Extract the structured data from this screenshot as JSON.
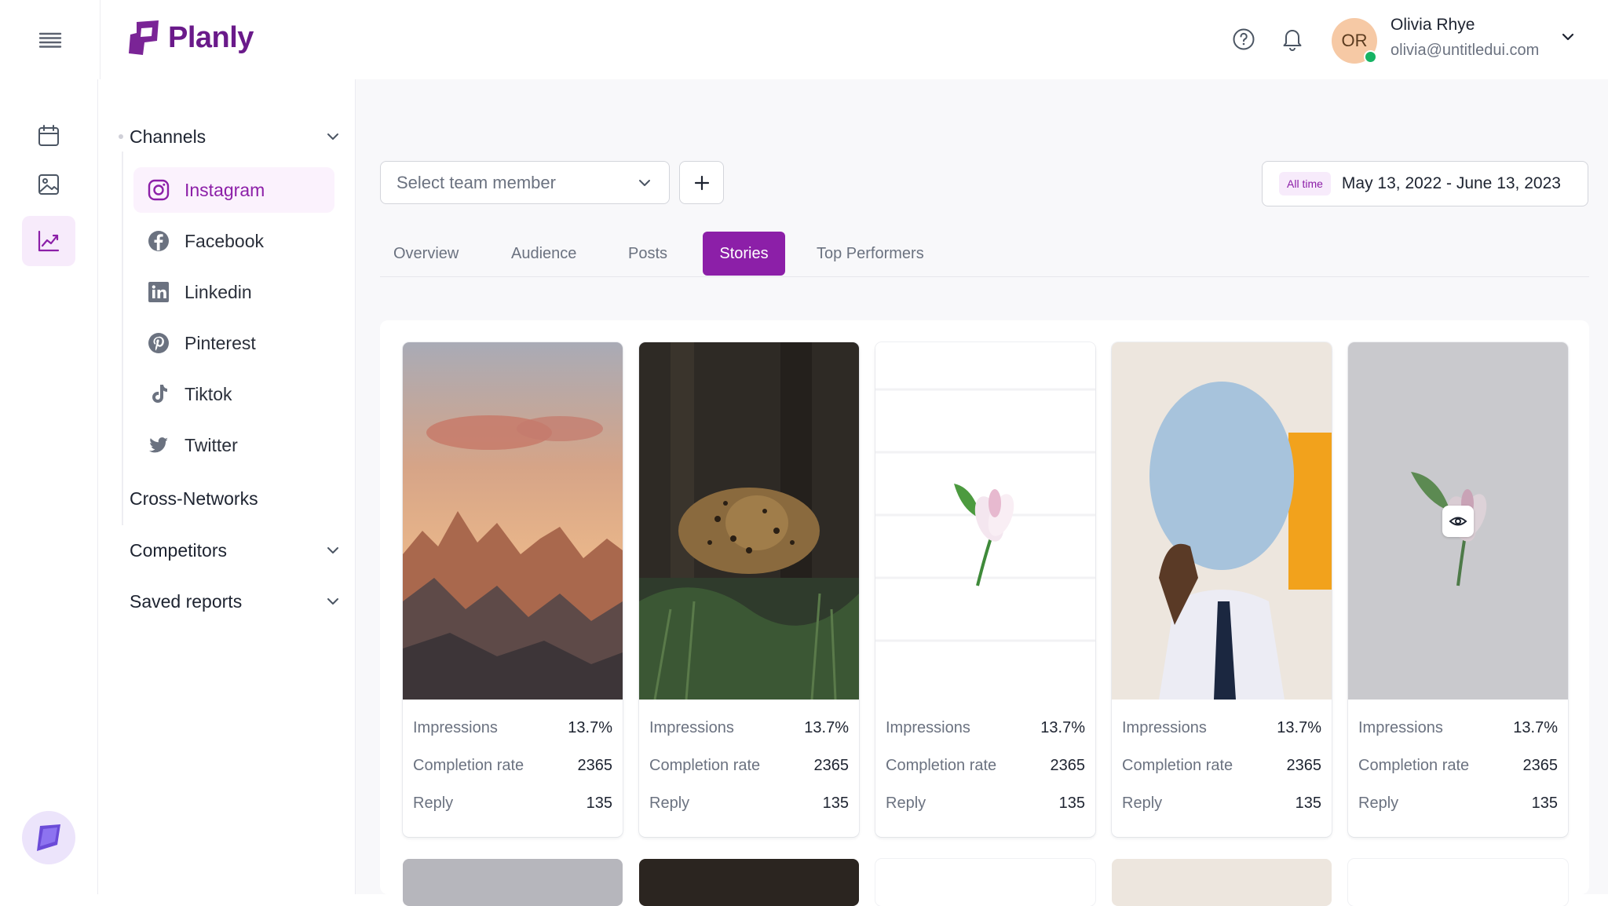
{
  "app": {
    "name": "Planly",
    "brand_color": "#6a1a8a",
    "accent": "#8c1fa8"
  },
  "header": {
    "menu_icon": "hamburger-menu-icon",
    "help_icon": "help-circle-icon",
    "bell_icon": "bell-icon",
    "user": {
      "initials": "OR",
      "name": "Olivia Rhye",
      "email": "olivia@untitledui.com",
      "status": "online"
    }
  },
  "rail": {
    "items": [
      "calendar-icon",
      "image-icon",
      "analytics-icon"
    ],
    "active": "analytics-icon"
  },
  "sidebar": {
    "channels_label": "Channels",
    "channels": [
      {
        "label": "Instagram",
        "icon": "instagram-icon",
        "active": true
      },
      {
        "label": "Facebook",
        "icon": "facebook-icon"
      },
      {
        "label": "Linkedin",
        "icon": "linkedin-icon"
      },
      {
        "label": "Pinterest",
        "icon": "pinterest-icon"
      },
      {
        "label": "Tiktok",
        "icon": "tiktok-icon"
      },
      {
        "label": "Twitter",
        "icon": "twitter-icon"
      }
    ],
    "cross_networks": "Cross-Networks",
    "competitors": "Competitors",
    "saved_reports": "Saved reports"
  },
  "filters": {
    "team_member_placeholder": "Select team member",
    "date_badge": "All time",
    "date_range": "May 13, 2022 - June 13, 2023"
  },
  "tabs": [
    {
      "label": "Overview"
    },
    {
      "label": "Audience"
    },
    {
      "label": "Posts"
    },
    {
      "label": "Stories",
      "active": true
    },
    {
      "label": "Top Performers"
    }
  ],
  "stories": [
    {
      "image": "mountain-sunset",
      "stats": [
        {
          "label": "Impressions",
          "value": "13.7%"
        },
        {
          "label": "Completion rate",
          "value": "2365"
        },
        {
          "label": "Reply",
          "value": "135"
        }
      ]
    },
    {
      "image": "leopard-forest",
      "stats": [
        {
          "label": "Impressions",
          "value": "13.7%"
        },
        {
          "label": "Completion rate",
          "value": "2365"
        },
        {
          "label": "Reply",
          "value": "135"
        }
      ]
    },
    {
      "image": "lily-white",
      "stats": [
        {
          "label": "Impressions",
          "value": "13.7%"
        },
        {
          "label": "Completion rate",
          "value": "2365"
        },
        {
          "label": "Reply",
          "value": "135"
        }
      ]
    },
    {
      "image": "person-blue-oval",
      "stats": [
        {
          "label": "Impressions",
          "value": "13.7%"
        },
        {
          "label": "Completion rate",
          "value": "2365"
        },
        {
          "label": "Reply",
          "value": "135"
        }
      ]
    },
    {
      "image": "lily-grey-hover",
      "stats": [
        {
          "label": "Impressions",
          "value": "13.7%"
        },
        {
          "label": "Completion rate",
          "value": "2365"
        },
        {
          "label": "Reply",
          "value": "135"
        }
      ]
    }
  ]
}
